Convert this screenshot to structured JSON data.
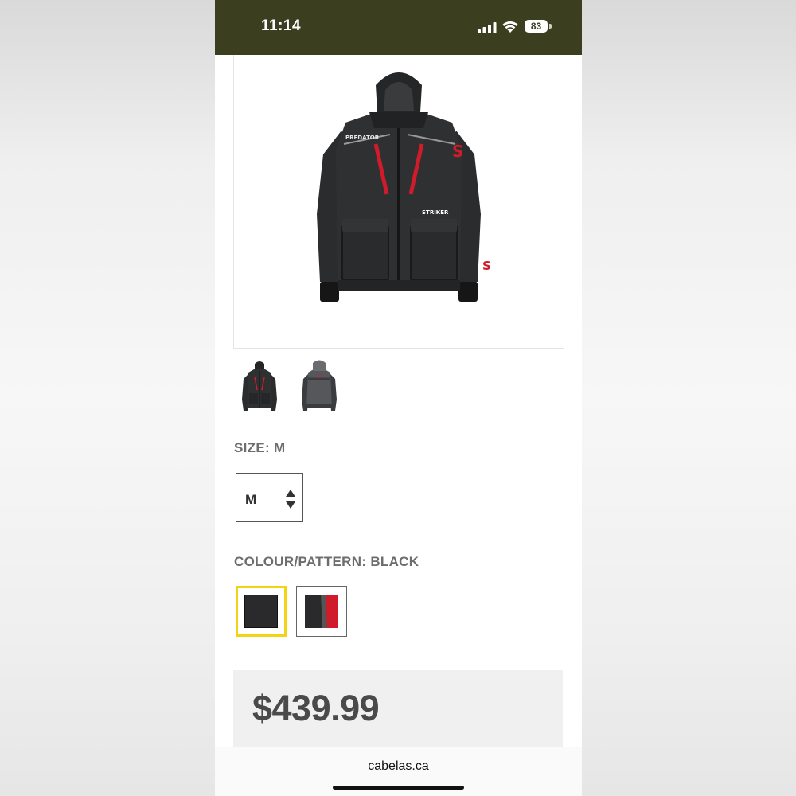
{
  "status_bar": {
    "time": "11:14",
    "battery": "83",
    "background_color": "#3b3f1f"
  },
  "product": {
    "images": [
      {
        "name": "jacket-front-image"
      },
      {
        "name": "jacket-back-image"
      }
    ],
    "jacket_chest_text": "PREDATOR",
    "jacket_brand_text": "STRIKER",
    "size": {
      "label": "SIZE: M",
      "selected": "M"
    },
    "colour": {
      "label": "COLOUR/PATTERN: BLACK",
      "swatches": [
        {
          "name": "Black",
          "colors": [
            "#2a2a2c"
          ],
          "selected": true
        },
        {
          "name": "Black/Red",
          "colors": [
            "#2a2a2c",
            "#d01c2a"
          ],
          "selected": false
        }
      ],
      "selected_border_color": "#f2d414"
    },
    "price": "$439.99"
  },
  "browser": {
    "url": "cabelas.ca"
  }
}
